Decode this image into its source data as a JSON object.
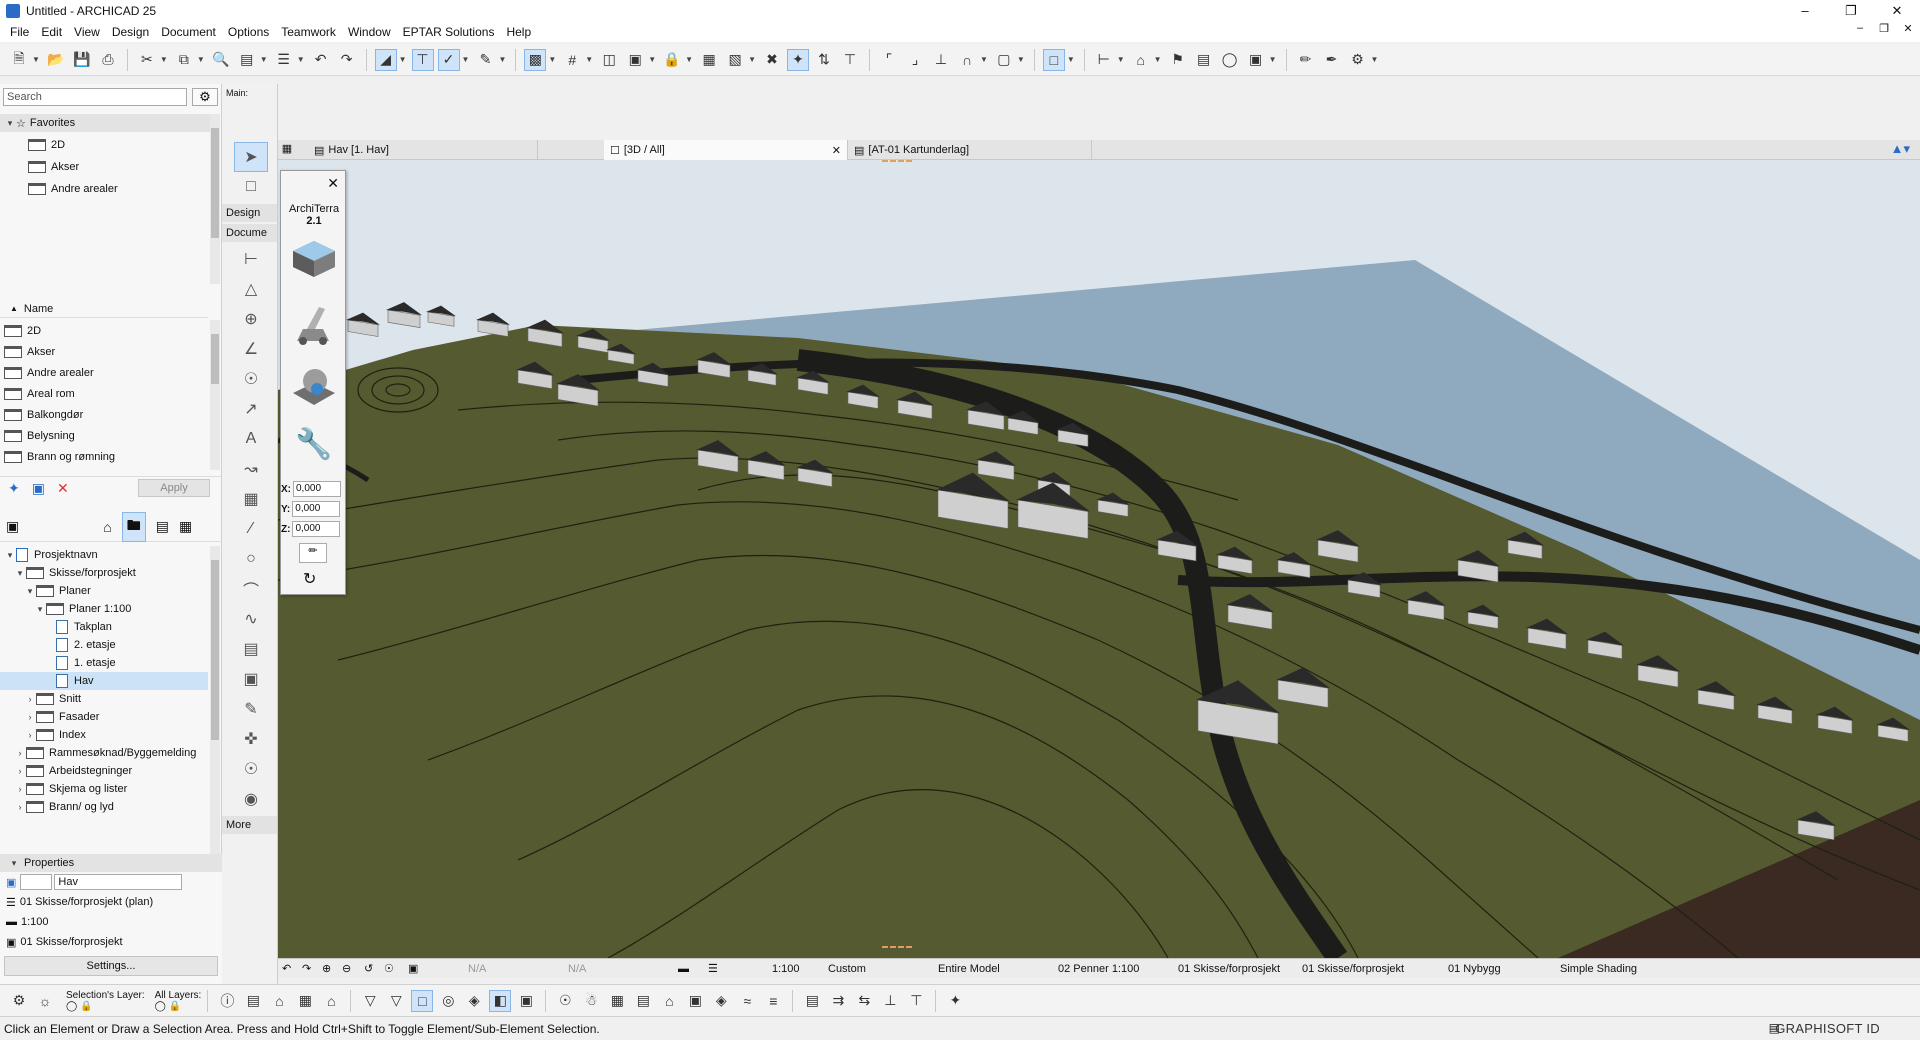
{
  "window": {
    "title": "Untitled - ARCHICAD 25"
  },
  "menu": [
    "File",
    "Edit",
    "View",
    "Design",
    "Document",
    "Options",
    "Teamwork",
    "Window",
    "EPTAR Solutions",
    "Help"
  ],
  "navigator": {
    "search_placeholder": "Search",
    "favorites_label": "Favorites",
    "favorites": [
      "2D",
      "Akser",
      "Andre arealer"
    ],
    "name_header": "Name",
    "attribute_items": [
      "2D",
      "Akser",
      "Andre arealer",
      "Areal rom",
      "Balkongdør",
      "Belysning",
      "Brann og rømning"
    ],
    "apply_label": "Apply",
    "tree": [
      {
        "label": "Prosjektnavn",
        "level": 0,
        "kind": "project",
        "open": true
      },
      {
        "label": "Skisse/forprosjekt",
        "level": 1,
        "kind": "folder",
        "open": true
      },
      {
        "label": "Planer",
        "level": 2,
        "kind": "folder",
        "open": true
      },
      {
        "label": "Planer 1:100",
        "level": 3,
        "kind": "folder",
        "open": true
      },
      {
        "label": "Takplan",
        "level": 4,
        "kind": "sheet"
      },
      {
        "label": "2. etasje",
        "level": 4,
        "kind": "sheet"
      },
      {
        "label": "1. etasje",
        "level": 4,
        "kind": "sheet"
      },
      {
        "label": "Hav",
        "level": 4,
        "kind": "sheet",
        "selected": true
      },
      {
        "label": "Snitt",
        "level": 2,
        "kind": "folder"
      },
      {
        "label": "Fasader",
        "level": 2,
        "kind": "folder"
      },
      {
        "label": "Index",
        "level": 2,
        "kind": "folder"
      },
      {
        "label": "Rammesøknad/Byggemelding",
        "level": 1,
        "kind": "folder"
      },
      {
        "label": "Arbeidstegninger",
        "level": 1,
        "kind": "folder"
      },
      {
        "label": "Skjema og lister",
        "level": 1,
        "kind": "folder"
      },
      {
        "label": "Brann/ og lyd",
        "level": 1,
        "kind": "folder"
      }
    ]
  },
  "properties": {
    "header": "Properties",
    "name_value": "Hav",
    "layer_combo": "01 Skisse/forprosjekt (plan)",
    "scale": "1:100",
    "model_view": "01 Skisse/forprosjekt",
    "settings_label": "Settings..."
  },
  "toolbox": {
    "main_label": "Main:",
    "design_label": "Design",
    "document_label": "Docume",
    "more_label": "More"
  },
  "tabs": [
    {
      "label": "Hav [1. Hav]"
    },
    {
      "label": "[3D / All]",
      "active": true
    },
    {
      "label": "[AT-01 Kartunderlag]"
    }
  ],
  "palette": {
    "title_line1": "ArchiTerra",
    "title_line2": "2.1",
    "x_label": "X:",
    "x_value": "0,000",
    "y_label": "Y:",
    "y_value": "0,000",
    "z_label": "Z:",
    "z_value": "0,000"
  },
  "view_status": {
    "na1": "N/A",
    "na2": "N/A",
    "scale": "1:100",
    "layer_combo": "Custom",
    "model": "Entire Model",
    "pen_set": "02 Penner 1:100",
    "mvo": "01 Skisse/forprosjekt",
    "dim": "01 Skisse/forprosjekt",
    "renovation": "01 Nybygg",
    "shading": "Simple Shading"
  },
  "bottom": {
    "selection_layer_label": "Selection's Layer:",
    "all_layers_label": "All Layers:"
  },
  "status_message": "Click an Element or Draw a Selection Area. Press and Hold Ctrl+Shift to Toggle Element/Sub-Element Selection.",
  "brand": "GRAPHISOFT ID",
  "colors": {
    "sea": "#8fa9be",
    "terrain": "#565a30",
    "road": "#1c1c1a",
    "roof": "#2a2a2a",
    "wall": "#cfcfcf",
    "accent": "#2a6bc8"
  }
}
